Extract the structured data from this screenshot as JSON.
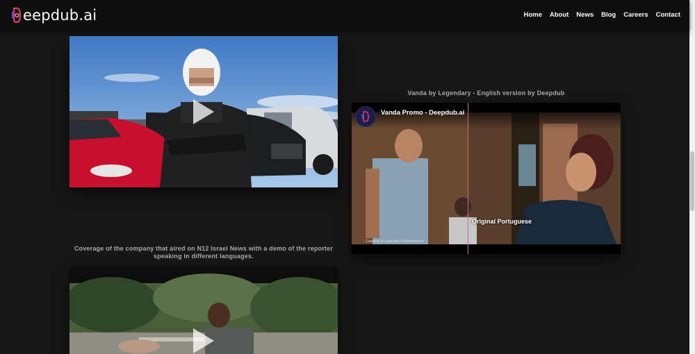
{
  "header": {
    "logo_text": "eepdub.ai",
    "nav": [
      "Home",
      "About",
      "News",
      "Blog",
      "Careers",
      "Contact"
    ]
  },
  "videos": {
    "vanda": {
      "caption": "Vanda by Legendary - English version by Deepdub",
      "yt_title": "Vanda Promo - Deepdub.ai",
      "overlay": "Original Portuguese",
      "courtesy": "Courtesy of Legendary Entertainment"
    },
    "n12": {
      "caption": "Coverage of the company that aired on N12 Israel News with a demo of the reporter speaking in different languages."
    }
  },
  "colors": {
    "accent_pink": "#e23a6d",
    "accent_blue": "#3d4cff",
    "background": "#171717"
  }
}
